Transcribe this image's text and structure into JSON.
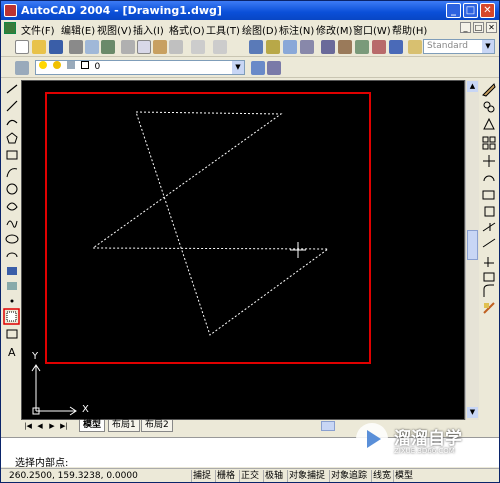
{
  "window": {
    "title": "AutoCAD 2004 - [Drawing1.dwg]",
    "minimize": "_",
    "maximize": "□",
    "close": "✕"
  },
  "menu": {
    "items": [
      "文件(F)",
      "编辑(E)",
      "视图(V)",
      "插入(I)",
      "格式(O)",
      "工具(T)",
      "绘图(D)",
      "标注(N)",
      "修改(M)",
      "窗口(W)",
      "帮助(H)"
    ],
    "doc_buttons": [
      "_",
      "□",
      "✕"
    ]
  },
  "toolbar": {
    "text_style": "Standard",
    "layer_value": "0"
  },
  "drawing": {
    "ucs_x": "X",
    "ucs_y": "Y"
  },
  "layout_tabs": [
    "模型",
    "布局1",
    "布局2"
  ],
  "command": {
    "prompt": "选择内部点:"
  },
  "status": {
    "coords": "260.2500,  159.3238,  0.0000",
    "buttons": [
      "捕捉",
      "栅格",
      "正交",
      "极轴",
      "对象捕捉",
      "对象追踪",
      "线宽",
      "模型"
    ]
  },
  "watermark": {
    "brand": "溜溜自学",
    "site": "ZIXUE.3D66.COM"
  },
  "colors": {
    "frame": "#e00000",
    "star": "#ffffff",
    "titlebar": "#0a4fd8"
  }
}
